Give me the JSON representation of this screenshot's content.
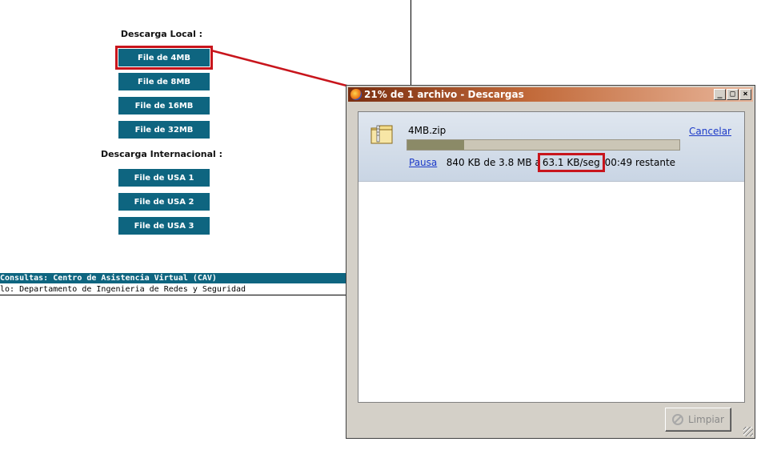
{
  "local": {
    "title": "Descarga Local :",
    "buttons": [
      "File de 4MB",
      "File de 8MB",
      "File de 16MB",
      "File de 32MB"
    ]
  },
  "international": {
    "title": "Descarga Internacional :",
    "buttons": [
      "File de USA 1",
      "File de USA 2",
      "File de USA 3"
    ]
  },
  "footer": {
    "bar": "Consultas: Centro de Asistencia Virtual (CAV)",
    "sub": "lo: Departamento de Ingenieria de Redes y Seguridad"
  },
  "window": {
    "title": "21% de 1 archivo - Descargas",
    "controls": [
      "_",
      "□",
      "×"
    ]
  },
  "download": {
    "filename": "4MB.zip",
    "cancel": "Cancelar",
    "progress_percent": 21,
    "pause": "Pausa",
    "amount": "840 KB de 3.8 MB a",
    "speed": "63.1 KB/seg",
    "remaining": "00:49 restante"
  },
  "clear_button": "Limpiar",
  "colors": {
    "button_bg": "#0e6580",
    "highlight": "#c8151c",
    "link": "#1c3ac8"
  }
}
